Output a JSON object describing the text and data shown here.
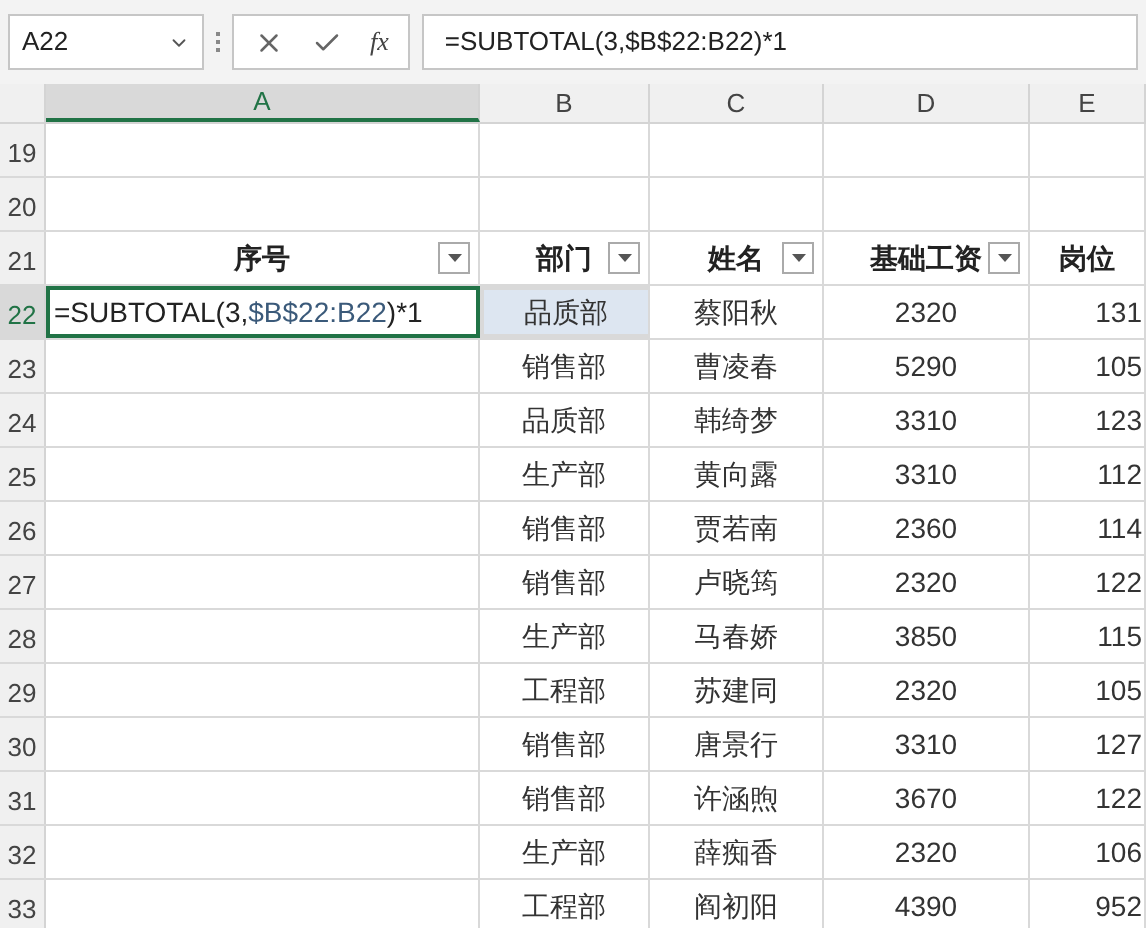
{
  "name_box": "A22",
  "function_label": "fx",
  "formula": "=SUBTOTAL(3,$B$22:B22)*1",
  "columns": [
    {
      "label": "A",
      "selected": true
    },
    {
      "label": "B",
      "selected": false
    },
    {
      "label": "C",
      "selected": false
    },
    {
      "label": "D",
      "selected": false
    },
    {
      "label": "E",
      "selected": false
    }
  ],
  "rows": [
    {
      "number": "19",
      "selected": false,
      "kind": "empty"
    },
    {
      "number": "20",
      "selected": false,
      "kind": "empty"
    },
    {
      "number": "21",
      "selected": false,
      "kind": "header",
      "cells": [
        "序号",
        "部门",
        "姓名",
        "基础工资",
        "岗位"
      ]
    },
    {
      "number": "22",
      "selected": true,
      "kind": "editing",
      "edit": {
        "before": "=SUBTOTAL(3,",
        "reference": "$B$22:B22",
        "after": ")*1"
      },
      "cells": [
        "",
        "品质部",
        "蔡阳秋",
        "2320",
        "131"
      ]
    },
    {
      "number": "23",
      "selected": false,
      "kind": "data",
      "cells": [
        "",
        "销售部",
        "曹凌春",
        "5290",
        "105"
      ]
    },
    {
      "number": "24",
      "selected": false,
      "kind": "data",
      "cells": [
        "",
        "品质部",
        "韩绮梦",
        "3310",
        "123"
      ]
    },
    {
      "number": "25",
      "selected": false,
      "kind": "data",
      "cells": [
        "",
        "生产部",
        "黄向露",
        "3310",
        "112"
      ]
    },
    {
      "number": "26",
      "selected": false,
      "kind": "data",
      "cells": [
        "",
        "销售部",
        "贾若南",
        "2360",
        "114"
      ]
    },
    {
      "number": "27",
      "selected": false,
      "kind": "data",
      "cells": [
        "",
        "销售部",
        "卢晓筠",
        "2320",
        "122"
      ]
    },
    {
      "number": "28",
      "selected": false,
      "kind": "data",
      "cells": [
        "",
        "生产部",
        "马春娇",
        "3850",
        "115"
      ]
    },
    {
      "number": "29",
      "selected": false,
      "kind": "data",
      "cells": [
        "",
        "工程部",
        "苏建同",
        "2320",
        "105"
      ]
    },
    {
      "number": "30",
      "selected": false,
      "kind": "data",
      "cells": [
        "",
        "销售部",
        "唐景行",
        "3310",
        "127"
      ]
    },
    {
      "number": "31",
      "selected": false,
      "kind": "data",
      "cells": [
        "",
        "销售部",
        "许涵煦",
        "3670",
        "122"
      ]
    },
    {
      "number": "32",
      "selected": false,
      "kind": "data",
      "cells": [
        "",
        "生产部",
        "薛痴香",
        "2320",
        "106"
      ]
    },
    {
      "number": "33",
      "selected": false,
      "kind": "data",
      "cells": [
        "",
        "工程部",
        "阎初阳",
        "4390",
        "952"
      ]
    }
  ]
}
